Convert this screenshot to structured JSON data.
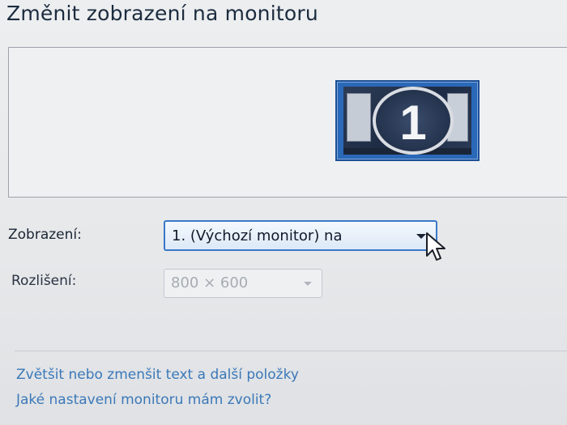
{
  "page": {
    "title": "Změnit zobrazení na monitoru"
  },
  "preview": {
    "monitor_number": "1"
  },
  "display": {
    "label": "Zobrazení:",
    "selected_value": "1. (Výchozí monitor) na"
  },
  "resolution": {
    "label": "Rozlišení:",
    "selected_value": "800 × 600",
    "enabled": false
  },
  "links": {
    "text_size": "Zvětšit nebo zmenšit text a další položky",
    "which_settings": "Jaké nastavení monitoru mám zvolit?"
  },
  "colors": {
    "title": "#1c2b3e",
    "link": "#3b78b8",
    "monitor_blue": "#2a68b8",
    "select_border_active": "#3a78c8"
  },
  "icons": {
    "cursor": "arrow-cursor-icon",
    "dropdown": "chevron-down-icon"
  }
}
